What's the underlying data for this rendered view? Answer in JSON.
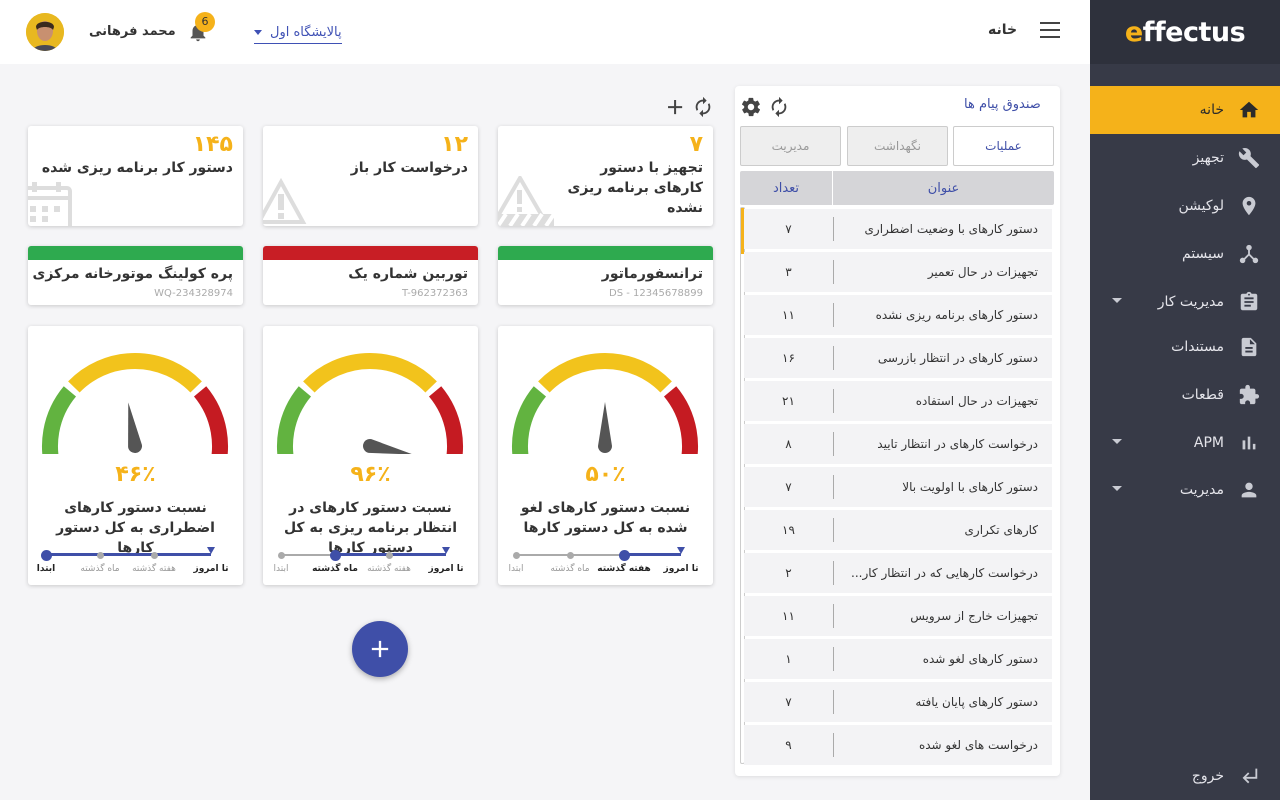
{
  "brand": {
    "logo_e": "e",
    "logo_rest": "ffectus"
  },
  "sidebar": {
    "items": [
      {
        "label": "خانه",
        "icon": "home-icon"
      },
      {
        "label": "تجهیز",
        "icon": "wrench-icon"
      },
      {
        "label": "لوکیشن",
        "icon": "location-pin-icon"
      },
      {
        "label": "سیستم",
        "icon": "hierarchy-icon"
      },
      {
        "label": "مدیریت کار",
        "icon": "clipboard-icon"
      },
      {
        "label": "مستندات",
        "icon": "document-icon"
      },
      {
        "label": "قطعات",
        "icon": "puzzle-icon"
      },
      {
        "label": "APM",
        "icon": "bar-chart-icon"
      },
      {
        "label": "مدیریت",
        "icon": "person-icon"
      }
    ],
    "logout_label": "خروج",
    "accent": "#f5b21a"
  },
  "header": {
    "title": "خانه",
    "site_select": "پالایشگاه اول",
    "notification_count": "6",
    "user_name": "محمد فرهانی"
  },
  "toolbar": {
    "add": "add-icon",
    "refresh": "refresh-icon"
  },
  "stat_cards": [
    {
      "value": "۷",
      "label": "تجهیز با دستور کارهای برنامه ریزی نشده"
    },
    {
      "value": "۱۲",
      "label": "درخواست کار باز"
    },
    {
      "value": "۱۴۵",
      "label": "دستور کار برنامه ریزی شده"
    }
  ],
  "asset_cards": [
    {
      "name": "ترانسفورماتور",
      "code": "DS - 12345678899",
      "status_color": "#2eaa4f"
    },
    {
      "name": "توربین شماره یک",
      "code": "T-962372363",
      "status_color": "#c81e25"
    },
    {
      "name": "پره کولینگ موتورخانه مرکزی",
      "code": "WQ-234328974",
      "status_color": "#2eaa4f"
    }
  ],
  "gauges": [
    {
      "percent": "۵۰٪",
      "value": 50,
      "label": "نسبت دستور کارهای لغو شده به کل دستور کارها",
      "selected": 2
    },
    {
      "percent": "۹۶٪",
      "value": 96,
      "label": "نسبت دستور کارهای در انتظار برنامه ریزی به کل دستور کارها",
      "selected": 1
    },
    {
      "percent": "۴۶٪",
      "value": 46,
      "label": "نسبت دستور کارهای اضطراری به کل دستور کارها",
      "selected": 0
    }
  ],
  "timeline_labels": [
    "ابتدا",
    "ماه گذشته",
    "هفته گذشته",
    "تا امروز"
  ],
  "inbox": {
    "title": "صندوق پیام ها",
    "tabs": [
      "عملیات",
      "نگهداشت",
      "مدیریت"
    ],
    "col_title": "عنوان",
    "col_count": "تعداد",
    "rows": [
      {
        "title": "دستور کارهای با وضعیت اضطراری",
        "count": "۷"
      },
      {
        "title": "تجهیزات در حال تعمیر",
        "count": "۳"
      },
      {
        "title": "دستور کارهای برنامه ریزی نشده",
        "count": "۱۱"
      },
      {
        "title": "دستور کارهای در انتظار بازرسی",
        "count": "۱۶"
      },
      {
        "title": "تجهیزات در حال استفاده",
        "count": "۲۱"
      },
      {
        "title": "درخواست کارهای در انتظار تایید",
        "count": "۸"
      },
      {
        "title": "دستور کارهای با اولویت بالا",
        "count": "۷"
      },
      {
        "title": "کارهای تکراری",
        "count": "۱۹"
      },
      {
        "title": "درخواست کارهایی که در انتظار کار...",
        "count": "۲"
      },
      {
        "title": "تجهیزات خارج از سرویس",
        "count": "۱۱"
      },
      {
        "title": "دستور کارهای لغو شده",
        "count": "۱"
      },
      {
        "title": "دستور کارهای پایان یافته",
        "count": "۷"
      },
      {
        "title": "درخواست های لغو شده",
        "count": "۹"
      }
    ]
  },
  "fab": "add-icon"
}
